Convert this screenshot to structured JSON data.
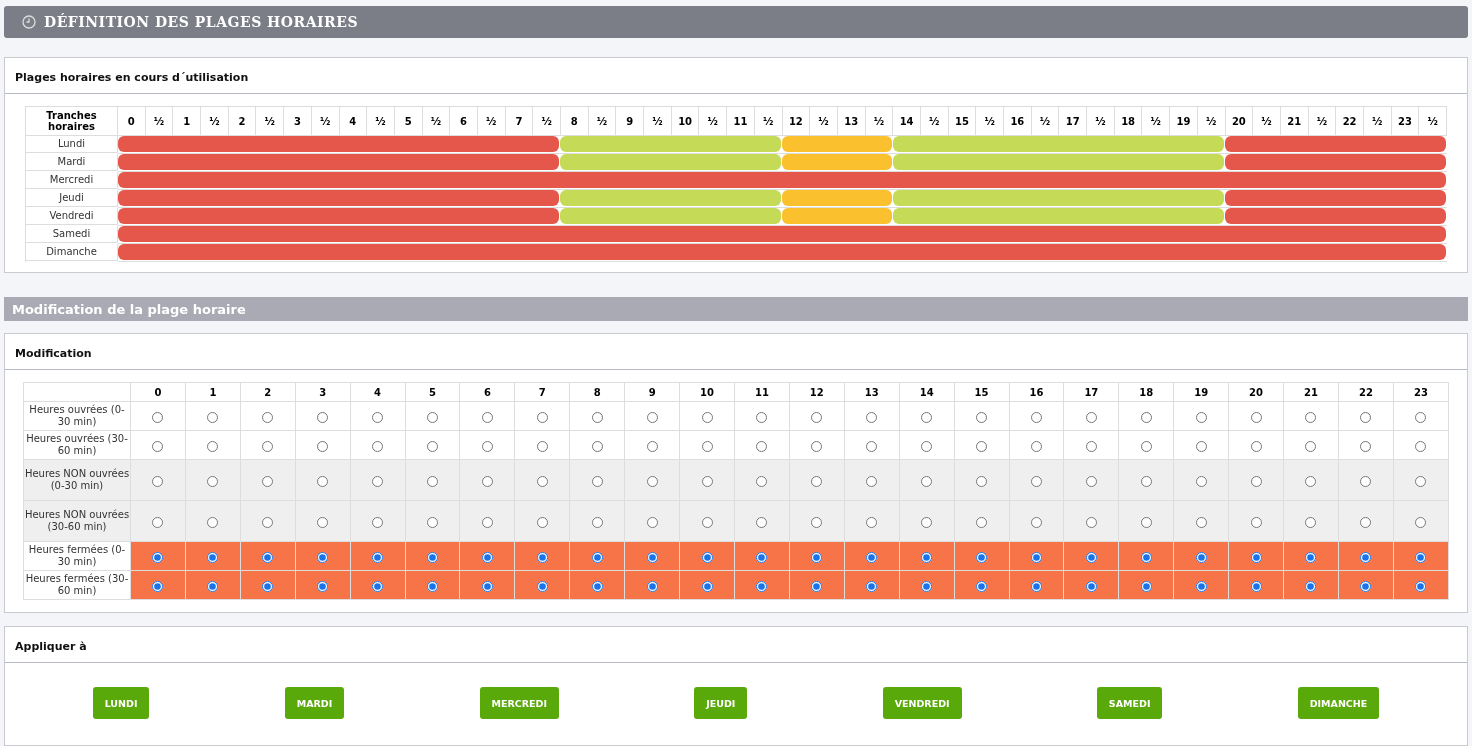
{
  "page_title": "DÉFINITION DES PLAGES HORAIRES",
  "current": {
    "title": "Plages horaires en cours d´utilisation",
    "corner_label": "Tranches horaires",
    "hours": [
      "0",
      "½",
      "1",
      "½",
      "2",
      "½",
      "3",
      "½",
      "4",
      "½",
      "5",
      "½",
      "6",
      "½",
      "7",
      "½",
      "8",
      "½",
      "9",
      "½",
      "10",
      "½",
      "11",
      "½",
      "12",
      "½",
      "13",
      "½",
      "14",
      "½",
      "15",
      "½",
      "16",
      "½",
      "17",
      "½",
      "18",
      "½",
      "19",
      "½",
      "20",
      "½",
      "21",
      "½",
      "22",
      "½",
      "23",
      "½"
    ],
    "days": [
      {
        "name": "Lundi",
        "slots": [
          {
            "kind": "closed"
          },
          {
            "kind": "closed"
          },
          {
            "kind": "closed"
          },
          {
            "kind": "closed"
          },
          {
            "kind": "closed"
          },
          {
            "kind": "closed"
          },
          {
            "kind": "closed"
          },
          {
            "kind": "closed"
          },
          {
            "kind": "closed"
          },
          {
            "kind": "closed"
          },
          {
            "kind": "closed"
          },
          {
            "kind": "closed"
          },
          {
            "kind": "closed"
          },
          {
            "kind": "closed"
          },
          {
            "kind": "closed"
          },
          {
            "kind": "closed"
          },
          {
            "kind": "open"
          },
          {
            "kind": "open"
          },
          {
            "kind": "open"
          },
          {
            "kind": "open"
          },
          {
            "kind": "open"
          },
          {
            "kind": "open"
          },
          {
            "kind": "open"
          },
          {
            "kind": "open"
          },
          {
            "kind": "nonopen"
          },
          {
            "kind": "nonopen"
          },
          {
            "kind": "nonopen"
          },
          {
            "kind": "nonopen"
          },
          {
            "kind": "open"
          },
          {
            "kind": "open"
          },
          {
            "kind": "open"
          },
          {
            "kind": "open"
          },
          {
            "kind": "open"
          },
          {
            "kind": "open"
          },
          {
            "kind": "open"
          },
          {
            "kind": "open"
          },
          {
            "kind": "open"
          },
          {
            "kind": "open"
          },
          {
            "kind": "open"
          },
          {
            "kind": "open"
          },
          {
            "kind": "closed"
          },
          {
            "kind": "closed"
          },
          {
            "kind": "closed"
          },
          {
            "kind": "closed"
          },
          {
            "kind": "closed"
          },
          {
            "kind": "closed"
          },
          {
            "kind": "closed"
          },
          {
            "kind": "closed"
          }
        ]
      },
      {
        "name": "Mardi",
        "slots": [
          {
            "kind": "closed"
          },
          {
            "kind": "closed"
          },
          {
            "kind": "closed"
          },
          {
            "kind": "closed"
          },
          {
            "kind": "closed"
          },
          {
            "kind": "closed"
          },
          {
            "kind": "closed"
          },
          {
            "kind": "closed"
          },
          {
            "kind": "closed"
          },
          {
            "kind": "closed"
          },
          {
            "kind": "closed"
          },
          {
            "kind": "closed"
          },
          {
            "kind": "closed"
          },
          {
            "kind": "closed"
          },
          {
            "kind": "closed"
          },
          {
            "kind": "closed"
          },
          {
            "kind": "open"
          },
          {
            "kind": "open"
          },
          {
            "kind": "open"
          },
          {
            "kind": "open"
          },
          {
            "kind": "open"
          },
          {
            "kind": "open"
          },
          {
            "kind": "open"
          },
          {
            "kind": "open"
          },
          {
            "kind": "nonopen"
          },
          {
            "kind": "nonopen"
          },
          {
            "kind": "nonopen"
          },
          {
            "kind": "nonopen"
          },
          {
            "kind": "open"
          },
          {
            "kind": "open"
          },
          {
            "kind": "open"
          },
          {
            "kind": "open"
          },
          {
            "kind": "open"
          },
          {
            "kind": "open"
          },
          {
            "kind": "open"
          },
          {
            "kind": "open"
          },
          {
            "kind": "open"
          },
          {
            "kind": "open"
          },
          {
            "kind": "open"
          },
          {
            "kind": "open"
          },
          {
            "kind": "closed"
          },
          {
            "kind": "closed"
          },
          {
            "kind": "closed"
          },
          {
            "kind": "closed"
          },
          {
            "kind": "closed"
          },
          {
            "kind": "closed"
          },
          {
            "kind": "closed"
          },
          {
            "kind": "closed"
          }
        ]
      },
      {
        "name": "Mercredi",
        "slots": [
          {
            "kind": "closed"
          },
          {
            "kind": "closed"
          },
          {
            "kind": "closed"
          },
          {
            "kind": "closed"
          },
          {
            "kind": "closed"
          },
          {
            "kind": "closed"
          },
          {
            "kind": "closed"
          },
          {
            "kind": "closed"
          },
          {
            "kind": "closed"
          },
          {
            "kind": "closed"
          },
          {
            "kind": "closed"
          },
          {
            "kind": "closed"
          },
          {
            "kind": "closed"
          },
          {
            "kind": "closed"
          },
          {
            "kind": "closed"
          },
          {
            "kind": "closed"
          },
          {
            "kind": "closed"
          },
          {
            "kind": "closed"
          },
          {
            "kind": "closed"
          },
          {
            "kind": "closed"
          },
          {
            "kind": "closed"
          },
          {
            "kind": "closed"
          },
          {
            "kind": "closed"
          },
          {
            "kind": "closed"
          },
          {
            "kind": "closed"
          },
          {
            "kind": "closed"
          },
          {
            "kind": "closed"
          },
          {
            "kind": "closed"
          },
          {
            "kind": "closed"
          },
          {
            "kind": "closed"
          },
          {
            "kind": "closed"
          },
          {
            "kind": "closed"
          },
          {
            "kind": "closed"
          },
          {
            "kind": "closed"
          },
          {
            "kind": "closed"
          },
          {
            "kind": "closed"
          },
          {
            "kind": "closed"
          },
          {
            "kind": "closed"
          },
          {
            "kind": "closed"
          },
          {
            "kind": "closed"
          },
          {
            "kind": "closed"
          },
          {
            "kind": "closed"
          },
          {
            "kind": "closed"
          },
          {
            "kind": "closed"
          },
          {
            "kind": "closed"
          },
          {
            "kind": "closed"
          },
          {
            "kind": "closed"
          },
          {
            "kind": "closed"
          }
        ]
      },
      {
        "name": "Jeudi",
        "slots": [
          {
            "kind": "closed"
          },
          {
            "kind": "closed"
          },
          {
            "kind": "closed"
          },
          {
            "kind": "closed"
          },
          {
            "kind": "closed"
          },
          {
            "kind": "closed"
          },
          {
            "kind": "closed"
          },
          {
            "kind": "closed"
          },
          {
            "kind": "closed"
          },
          {
            "kind": "closed"
          },
          {
            "kind": "closed"
          },
          {
            "kind": "closed"
          },
          {
            "kind": "closed"
          },
          {
            "kind": "closed"
          },
          {
            "kind": "closed"
          },
          {
            "kind": "closed"
          },
          {
            "kind": "open"
          },
          {
            "kind": "open"
          },
          {
            "kind": "open"
          },
          {
            "kind": "open"
          },
          {
            "kind": "open"
          },
          {
            "kind": "open"
          },
          {
            "kind": "open"
          },
          {
            "kind": "open"
          },
          {
            "kind": "nonopen"
          },
          {
            "kind": "nonopen"
          },
          {
            "kind": "nonopen"
          },
          {
            "kind": "nonopen"
          },
          {
            "kind": "open"
          },
          {
            "kind": "open"
          },
          {
            "kind": "open"
          },
          {
            "kind": "open"
          },
          {
            "kind": "open"
          },
          {
            "kind": "open"
          },
          {
            "kind": "open"
          },
          {
            "kind": "open"
          },
          {
            "kind": "open"
          },
          {
            "kind": "open"
          },
          {
            "kind": "open"
          },
          {
            "kind": "open"
          },
          {
            "kind": "closed"
          },
          {
            "kind": "closed"
          },
          {
            "kind": "closed"
          },
          {
            "kind": "closed"
          },
          {
            "kind": "closed"
          },
          {
            "kind": "closed"
          },
          {
            "kind": "closed"
          },
          {
            "kind": "closed"
          }
        ]
      },
      {
        "name": "Vendredi",
        "slots": [
          {
            "kind": "closed"
          },
          {
            "kind": "closed"
          },
          {
            "kind": "closed"
          },
          {
            "kind": "closed"
          },
          {
            "kind": "closed"
          },
          {
            "kind": "closed"
          },
          {
            "kind": "closed"
          },
          {
            "kind": "closed"
          },
          {
            "kind": "closed"
          },
          {
            "kind": "closed"
          },
          {
            "kind": "closed"
          },
          {
            "kind": "closed"
          },
          {
            "kind": "closed"
          },
          {
            "kind": "closed"
          },
          {
            "kind": "closed"
          },
          {
            "kind": "closed"
          },
          {
            "kind": "open"
          },
          {
            "kind": "open"
          },
          {
            "kind": "open"
          },
          {
            "kind": "open"
          },
          {
            "kind": "open"
          },
          {
            "kind": "open"
          },
          {
            "kind": "open"
          },
          {
            "kind": "open"
          },
          {
            "kind": "nonopen"
          },
          {
            "kind": "nonopen"
          },
          {
            "kind": "nonopen"
          },
          {
            "kind": "nonopen"
          },
          {
            "kind": "open"
          },
          {
            "kind": "open"
          },
          {
            "kind": "open"
          },
          {
            "kind": "open"
          },
          {
            "kind": "open"
          },
          {
            "kind": "open"
          },
          {
            "kind": "open"
          },
          {
            "kind": "open"
          },
          {
            "kind": "open"
          },
          {
            "kind": "open"
          },
          {
            "kind": "open"
          },
          {
            "kind": "open"
          },
          {
            "kind": "closed"
          },
          {
            "kind": "closed"
          },
          {
            "kind": "closed"
          },
          {
            "kind": "closed"
          },
          {
            "kind": "closed"
          },
          {
            "kind": "closed"
          },
          {
            "kind": "closed"
          },
          {
            "kind": "closed"
          }
        ]
      },
      {
        "name": "Samedi",
        "slots": [
          {
            "kind": "closed"
          },
          {
            "kind": "closed"
          },
          {
            "kind": "closed"
          },
          {
            "kind": "closed"
          },
          {
            "kind": "closed"
          },
          {
            "kind": "closed"
          },
          {
            "kind": "closed"
          },
          {
            "kind": "closed"
          },
          {
            "kind": "closed"
          },
          {
            "kind": "closed"
          },
          {
            "kind": "closed"
          },
          {
            "kind": "closed"
          },
          {
            "kind": "closed"
          },
          {
            "kind": "closed"
          },
          {
            "kind": "closed"
          },
          {
            "kind": "closed"
          },
          {
            "kind": "closed"
          },
          {
            "kind": "closed"
          },
          {
            "kind": "closed"
          },
          {
            "kind": "closed"
          },
          {
            "kind": "closed"
          },
          {
            "kind": "closed"
          },
          {
            "kind": "closed"
          },
          {
            "kind": "closed"
          },
          {
            "kind": "closed"
          },
          {
            "kind": "closed"
          },
          {
            "kind": "closed"
          },
          {
            "kind": "closed"
          },
          {
            "kind": "closed"
          },
          {
            "kind": "closed"
          },
          {
            "kind": "closed"
          },
          {
            "kind": "closed"
          },
          {
            "kind": "closed"
          },
          {
            "kind": "closed"
          },
          {
            "kind": "closed"
          },
          {
            "kind": "closed"
          },
          {
            "kind": "closed"
          },
          {
            "kind": "closed"
          },
          {
            "kind": "closed"
          },
          {
            "kind": "closed"
          },
          {
            "kind": "closed"
          },
          {
            "kind": "closed"
          },
          {
            "kind": "closed"
          },
          {
            "kind": "closed"
          },
          {
            "kind": "closed"
          },
          {
            "kind": "closed"
          },
          {
            "kind": "closed"
          },
          {
            "kind": "closed"
          }
        ]
      },
      {
        "name": "Dimanche",
        "slots": [
          {
            "kind": "closed"
          },
          {
            "kind": "closed"
          },
          {
            "kind": "closed"
          },
          {
            "kind": "closed"
          },
          {
            "kind": "closed"
          },
          {
            "kind": "closed"
          },
          {
            "kind": "closed"
          },
          {
            "kind": "closed"
          },
          {
            "kind": "closed"
          },
          {
            "kind": "closed"
          },
          {
            "kind": "closed"
          },
          {
            "kind": "closed"
          },
          {
            "kind": "closed"
          },
          {
            "kind": "closed"
          },
          {
            "kind": "closed"
          },
          {
            "kind": "closed"
          },
          {
            "kind": "closed"
          },
          {
            "kind": "closed"
          },
          {
            "kind": "closed"
          },
          {
            "kind": "closed"
          },
          {
            "kind": "closed"
          },
          {
            "kind": "closed"
          },
          {
            "kind": "closed"
          },
          {
            "kind": "closed"
          },
          {
            "kind": "closed"
          },
          {
            "kind": "closed"
          },
          {
            "kind": "closed"
          },
          {
            "kind": "closed"
          },
          {
            "kind": "closed"
          },
          {
            "kind": "closed"
          },
          {
            "kind": "closed"
          },
          {
            "kind": "closed"
          },
          {
            "kind": "closed"
          },
          {
            "kind": "closed"
          },
          {
            "kind": "closed"
          },
          {
            "kind": "closed"
          },
          {
            "kind": "closed"
          },
          {
            "kind": "closed"
          },
          {
            "kind": "closed"
          },
          {
            "kind": "closed"
          },
          {
            "kind": "closed"
          },
          {
            "kind": "closed"
          },
          {
            "kind": "closed"
          },
          {
            "kind": "closed"
          },
          {
            "kind": "closed"
          },
          {
            "kind": "closed"
          },
          {
            "kind": "closed"
          },
          {
            "kind": "closed"
          }
        ]
      }
    ]
  },
  "section_title": "Modification de la plage horaire",
  "modification": {
    "title": "Modification",
    "hours": [
      "0",
      "1",
      "2",
      "3",
      "4",
      "5",
      "6",
      "7",
      "8",
      "9",
      "10",
      "11",
      "12",
      "13",
      "14",
      "15",
      "16",
      "17",
      "18",
      "19",
      "20",
      "21",
      "22",
      "23"
    ],
    "rows": [
      {
        "label": "Heures ouvrées (0-30 min)",
        "kind": "open",
        "cells": [
          {
            "selected": false
          },
          {
            "selected": false
          },
          {
            "selected": false
          },
          {
            "selected": false
          },
          {
            "selected": false
          },
          {
            "selected": false
          },
          {
            "selected": false
          },
          {
            "selected": false
          },
          {
            "selected": false
          },
          {
            "selected": false
          },
          {
            "selected": false
          },
          {
            "selected": false
          },
          {
            "selected": false
          },
          {
            "selected": false
          },
          {
            "selected": false
          },
          {
            "selected": false
          },
          {
            "selected": false
          },
          {
            "selected": false
          },
          {
            "selected": false
          },
          {
            "selected": false
          },
          {
            "selected": false
          },
          {
            "selected": false
          },
          {
            "selected": false
          },
          {
            "selected": false
          }
        ]
      },
      {
        "label": "Heures ouvrées (30-60 min)",
        "kind": "open",
        "cells": [
          {
            "selected": false
          },
          {
            "selected": false
          },
          {
            "selected": false
          },
          {
            "selected": false
          },
          {
            "selected": false
          },
          {
            "selected": false
          },
          {
            "selected": false
          },
          {
            "selected": false
          },
          {
            "selected": false
          },
          {
            "selected": false
          },
          {
            "selected": false
          },
          {
            "selected": false
          },
          {
            "selected": false
          },
          {
            "selected": false
          },
          {
            "selected": false
          },
          {
            "selected": false
          },
          {
            "selected": false
          },
          {
            "selected": false
          },
          {
            "selected": false
          },
          {
            "selected": false
          },
          {
            "selected": false
          },
          {
            "selected": false
          },
          {
            "selected": false
          },
          {
            "selected": false
          }
        ]
      },
      {
        "label": "Heures NON ouvrées (0-30 min)",
        "kind": "nonopen",
        "cells": [
          {
            "selected": false
          },
          {
            "selected": false
          },
          {
            "selected": false
          },
          {
            "selected": false
          },
          {
            "selected": false
          },
          {
            "selected": false
          },
          {
            "selected": false
          },
          {
            "selected": false
          },
          {
            "selected": false
          },
          {
            "selected": false
          },
          {
            "selected": false
          },
          {
            "selected": false
          },
          {
            "selected": false
          },
          {
            "selected": false
          },
          {
            "selected": false
          },
          {
            "selected": false
          },
          {
            "selected": false
          },
          {
            "selected": false
          },
          {
            "selected": false
          },
          {
            "selected": false
          },
          {
            "selected": false
          },
          {
            "selected": false
          },
          {
            "selected": false
          },
          {
            "selected": false
          }
        ]
      },
      {
        "label": "Heures NON ouvrées (30-60 min)",
        "kind": "nonopen",
        "cells": [
          {
            "selected": false
          },
          {
            "selected": false
          },
          {
            "selected": false
          },
          {
            "selected": false
          },
          {
            "selected": false
          },
          {
            "selected": false
          },
          {
            "selected": false
          },
          {
            "selected": false
          },
          {
            "selected": false
          },
          {
            "selected": false
          },
          {
            "selected": false
          },
          {
            "selected": false
          },
          {
            "selected": false
          },
          {
            "selected": false
          },
          {
            "selected": false
          },
          {
            "selected": false
          },
          {
            "selected": false
          },
          {
            "selected": false
          },
          {
            "selected": false
          },
          {
            "selected": false
          },
          {
            "selected": false
          },
          {
            "selected": false
          },
          {
            "selected": false
          },
          {
            "selected": false
          }
        ]
      },
      {
        "label": "Heures fermées (0-30 min)",
        "kind": "closed",
        "cells": [
          {
            "selected": true
          },
          {
            "selected": true
          },
          {
            "selected": true
          },
          {
            "selected": true
          },
          {
            "selected": true
          },
          {
            "selected": true
          },
          {
            "selected": true
          },
          {
            "selected": true
          },
          {
            "selected": true
          },
          {
            "selected": true
          },
          {
            "selected": true
          },
          {
            "selected": true
          },
          {
            "selected": true
          },
          {
            "selected": true
          },
          {
            "selected": true
          },
          {
            "selected": true
          },
          {
            "selected": true
          },
          {
            "selected": true
          },
          {
            "selected": true
          },
          {
            "selected": true
          },
          {
            "selected": true
          },
          {
            "selected": true
          },
          {
            "selected": true
          },
          {
            "selected": true
          }
        ]
      },
      {
        "label": "Heures fermées (30-60 min)",
        "kind": "closed",
        "cells": [
          {
            "selected": true
          },
          {
            "selected": true
          },
          {
            "selected": true
          },
          {
            "selected": true
          },
          {
            "selected": true
          },
          {
            "selected": true
          },
          {
            "selected": true
          },
          {
            "selected": true
          },
          {
            "selected": true
          },
          {
            "selected": true
          },
          {
            "selected": true
          },
          {
            "selected": true
          },
          {
            "selected": true
          },
          {
            "selected": true
          },
          {
            "selected": true
          },
          {
            "selected": true
          },
          {
            "selected": true
          },
          {
            "selected": true
          },
          {
            "selected": true
          },
          {
            "selected": true
          },
          {
            "selected": true
          },
          {
            "selected": true
          },
          {
            "selected": true
          },
          {
            "selected": true
          }
        ]
      }
    ]
  },
  "apply": {
    "title": "Appliquer à",
    "buttons": [
      "LUNDI",
      "MARDI",
      "MERCREDI",
      "JEUDI",
      "VENDREDI",
      "SAMEDI",
      "DIMANCHE"
    ]
  }
}
